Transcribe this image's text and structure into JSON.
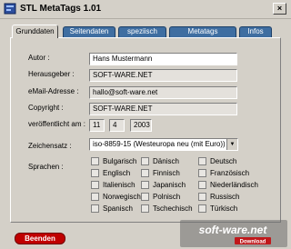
{
  "window": {
    "title": "STL MetaTags 1.01",
    "close_glyph": "×"
  },
  "tabs": [
    {
      "label": "Grunddaten",
      "active": true
    },
    {
      "label": "Seitendaten",
      "active": false
    },
    {
      "label": "speziisch",
      "active": false
    },
    {
      "label": "Metatags generieren",
      "active": false
    },
    {
      "label": "Infos",
      "active": false
    }
  ],
  "form": {
    "author": {
      "label": "Autor :",
      "value": "Hans Mustermann"
    },
    "publisher": {
      "label": "Herausgeber :",
      "value": "SOFT-WARE.NET"
    },
    "email": {
      "label": "eMail-Adresse :",
      "value": "hallo@soft-ware.net"
    },
    "copyright": {
      "label": "Copyright :",
      "value": "SOFT-WARE.NET"
    },
    "published": {
      "label": "veröffentlicht am :",
      "day": "11",
      "month": "4",
      "year": "2003"
    },
    "charset": {
      "label": "Zeichensatz :",
      "value": "iso-8859-15 (Westeuropa neu (mit Euro))"
    },
    "languages": {
      "label": "Sprachen :",
      "items": [
        "Bulgarisch",
        "Dänisch",
        "Deutsch",
        "Englisch",
        "Finnisch",
        "Französisch",
        "Italienisch",
        "Japanisch",
        "Niederländisch",
        "Norwegisch",
        "Polnisch",
        "Russisch",
        "Spanisch",
        "Tschechisch",
        "Türkisch"
      ]
    }
  },
  "footer": {
    "exit_label": "Beenden"
  },
  "watermark": {
    "brand": "soft-ware.net",
    "sub": "Download"
  },
  "icons": {
    "app": "blue-app-icon",
    "close": "close-icon",
    "dropdown": "chevron-down-icon"
  }
}
